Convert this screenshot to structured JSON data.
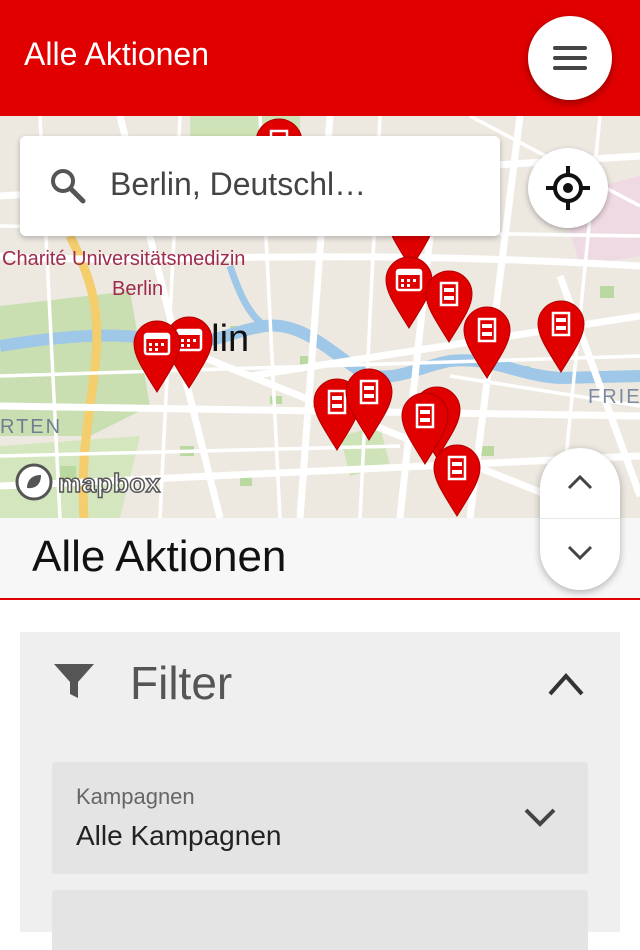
{
  "app_bar": {
    "title": "Alle Aktionen",
    "menu_icon": "hamburger-menu-icon",
    "background_color": "#e00000"
  },
  "map": {
    "search": {
      "value": "Berlin, Deutschl…",
      "icon": "search-icon"
    },
    "locate_icon": "my-location-icon",
    "attribution": "mapbox",
    "labels": {
      "poi_line1": "Charité Universitätsmedizin",
      "poi_line2": "Berlin",
      "city": "Berlin",
      "district_right": "FRIE",
      "district_left": "RTEN"
    },
    "marker_icons": [
      "calendar-icon",
      "building-icon"
    ],
    "marker_color": "#e00000"
  },
  "scroll_controls": {
    "up_icon": "chevron-up-icon",
    "down_icon": "chevron-down-icon"
  },
  "section": {
    "title": "Alle Aktionen"
  },
  "filter": {
    "title": "Filter",
    "icon": "filter-funnel-icon",
    "collapse_icon": "chevron-up-icon",
    "campaign_select": {
      "label": "Kampagnen",
      "value": "Alle Kampagnen"
    }
  }
}
